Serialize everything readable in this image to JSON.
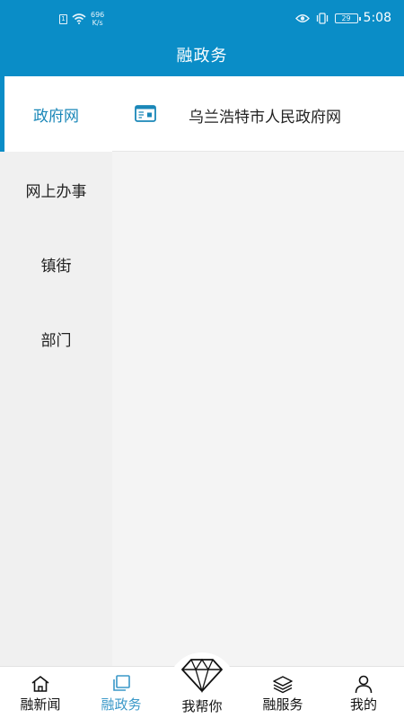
{
  "status_bar": {
    "network_speed_value": "696",
    "network_speed_unit": "K/s",
    "battery_level": "29",
    "time": "5:08"
  },
  "header": {
    "title": "融政务"
  },
  "sidebar": {
    "items": [
      {
        "label": "政府网",
        "active": true
      },
      {
        "label": "网上办事",
        "active": false
      },
      {
        "label": "镇街",
        "active": false
      },
      {
        "label": "部门",
        "active": false
      }
    ]
  },
  "content": {
    "rows": [
      {
        "icon": "id-card-icon",
        "label": "乌兰浩特市人民政府网"
      }
    ]
  },
  "bottom_nav": {
    "items": [
      {
        "label": "融新闻",
        "icon": "home-icon",
        "active": false
      },
      {
        "label": "融政务",
        "icon": "pages-icon",
        "active": true
      },
      {
        "label": "我帮你",
        "icon": "diamond-icon",
        "active": false
      },
      {
        "label": "融服务",
        "icon": "layers-icon",
        "active": false
      },
      {
        "label": "我的",
        "icon": "user-icon",
        "active": false
      }
    ]
  },
  "colors": {
    "brand": "#0a8dc7",
    "active_text": "#1a87b8",
    "active_nav": "#3a98c8"
  }
}
